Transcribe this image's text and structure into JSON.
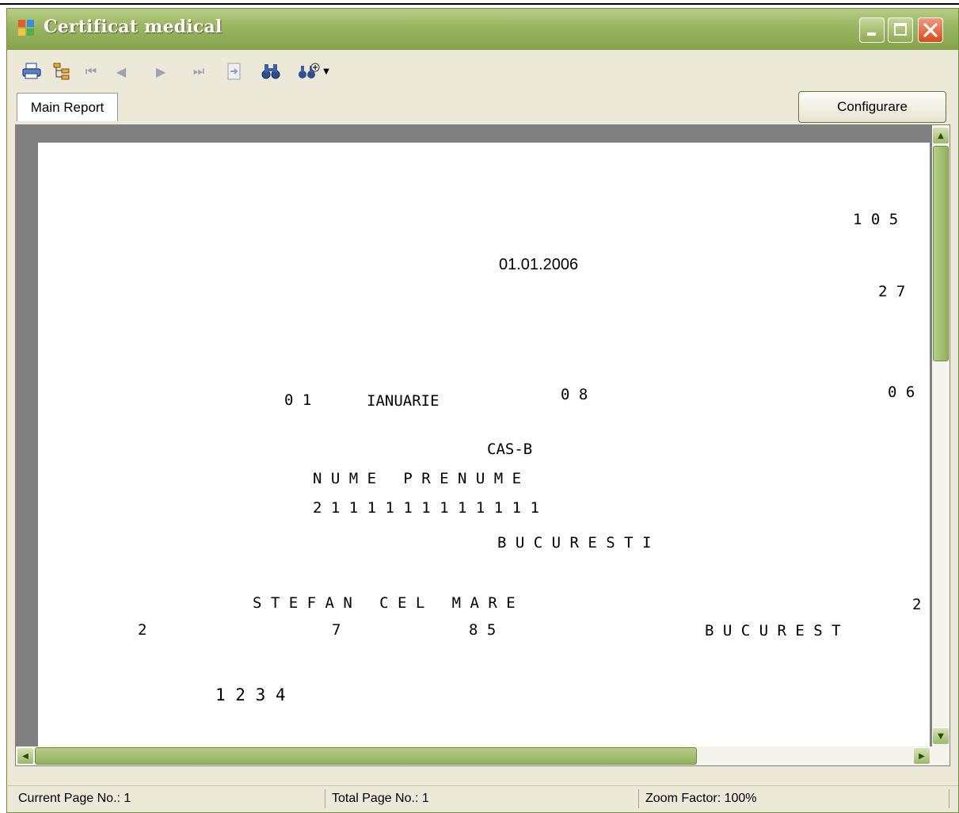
{
  "window": {
    "title": "Certificat medical",
    "title_bar_color": "#9cb763",
    "close_button_color": "#d9491d"
  },
  "toolbar": {
    "icons": [
      "print-icon",
      "tree-toggle-icon",
      "first-page-icon",
      "previous-page-icon",
      "next-page-icon",
      "last-page-icon",
      "goto-page-icon",
      "search-icon",
      "zoom-icon"
    ]
  },
  "tabs": [
    {
      "label": "Main Report"
    }
  ],
  "configure_button": {
    "label": "Configurare"
  },
  "report": {
    "top_right_number": "1 0 5",
    "issue_date": "01.01.2006",
    "second_right_number": "2 7",
    "day": "0 1",
    "month": "IANUARIE",
    "day_2": "0 8",
    "right_clipped": "0 6",
    "insurer": "CAS-B",
    "patient_name": "N U M E   P R E N U M E",
    "cnp": "2 1 1 1 1 1 1 1 1 1 1 1 1",
    "city_1": "B U C U R E S T I",
    "street": "S T E F A N   C E L   M A R E",
    "street_number": "2",
    "address_value_1": "2",
    "address_value_2": "7",
    "address_value_3": "8 5",
    "city_2": "B U C U R E S T",
    "code": "1 2 3 4"
  },
  "status": {
    "current_page": "Current Page No.: 1",
    "total_pages": "Total Page No.: 1",
    "zoom": "Zoom Factor: 100%"
  }
}
